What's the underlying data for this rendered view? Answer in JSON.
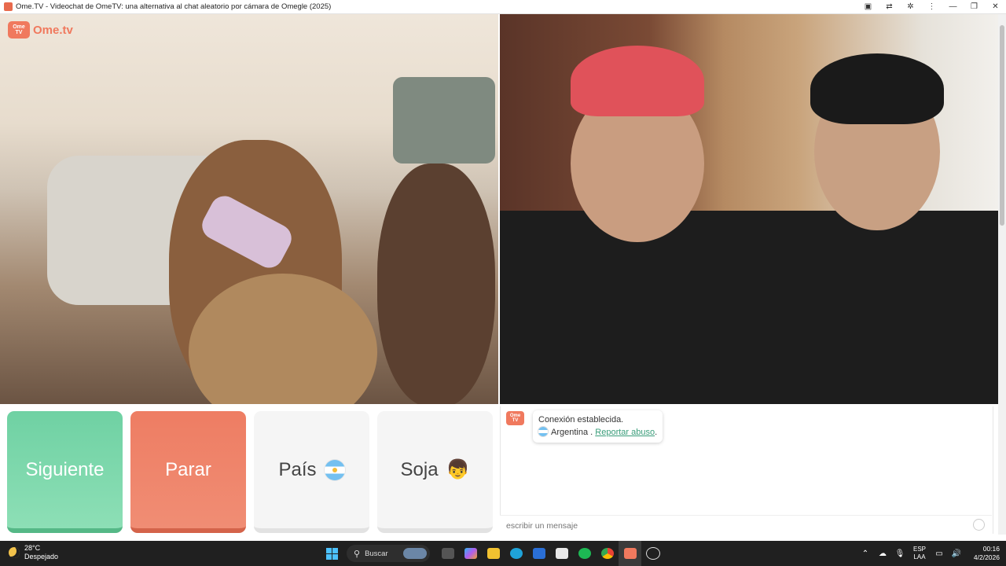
{
  "window": {
    "title": "Ome.TV - Videochat de OmeTV: una alternativa al chat aleatorio por cámara de Omegle (2025)"
  },
  "logo": {
    "badge_top": "Ome",
    "badge_bottom": "TV",
    "brand": "Ome.tv"
  },
  "buttons": {
    "next": "Siguiente",
    "stop": "Parar",
    "country": "País",
    "gender": "Soja"
  },
  "chat": {
    "status": "Conexión establecida.",
    "country": "Argentina",
    "separator": " . ",
    "report_link": "Reportar abuso",
    "report_suffix": ".",
    "input_placeholder": "escribir un mensaje"
  },
  "taskbar": {
    "weather_temp": "28°C",
    "weather_desc": "Despejado",
    "search_label": "Buscar",
    "lang_top": "ESP",
    "lang_bottom": "LAA",
    "time": "00:16",
    "date": "4/2/2026"
  },
  "colors": {
    "next": "#6fd1a3",
    "stop": "#ee7d63",
    "brand": "#f0795e",
    "link": "#3a9d7a"
  }
}
